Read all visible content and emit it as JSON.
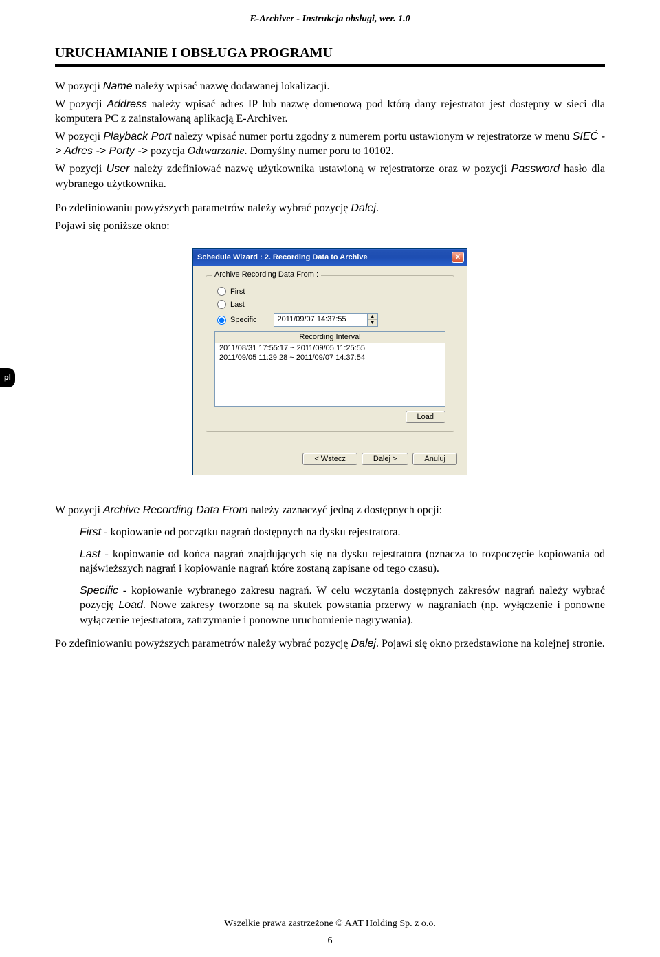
{
  "doc": {
    "header": "E-Archiver - Instrukcja obsługi, wer. 1.0",
    "section_title": "URUCHAMIANIE I OBSŁUGA PROGRAMU",
    "lang_tab": "pl",
    "footer": "Wszelkie prawa zastrzeżone © AAT Holding Sp. z o.o.",
    "page_number": "6"
  },
  "para": {
    "p1a": "W pozycji ",
    "p1_name": "Name",
    "p1b": " należy wpisać nazwę dodawanej lokalizacji.",
    "p2a": "W pozycji ",
    "p2_addr": "Address",
    "p2b": " należy wpisać adres IP lub nazwę domenową pod którą dany rejestrator jest dostępny w sieci dla komputera PC z zainstalowaną aplikacją E-Archiver.",
    "p3a": "W pozycji ",
    "p3_pb": "Playback Port",
    "p3b": " należy wpisać numer portu zgodny z numerem portu ustawionym w rejestratorze w menu ",
    "p3_menu": "SIEĆ -> Adres -> Porty ->",
    "p3c": " pozycja ",
    "p3_odt": "Odtwarzanie",
    "p3d": ". Domyślny numer poru to 10102.",
    "p4a": "W pozycji ",
    "p4_user": "User",
    "p4b": " należy zdefiniować nazwę użytkownika ustawioną w rejestratorze oraz w pozycji ",
    "p4_pw": "Password",
    "p4c": " hasło dla wybranego użytkownika.",
    "p5a": "Po zdefiniowaniu powyższych parametrów należy wybrać pozycję ",
    "p5_dalej": "Dalej",
    "p5b": ".",
    "p6": "Pojawi się poniższe okno:"
  },
  "dialog": {
    "title": "Schedule Wizard : 2. Recording Data to Archive",
    "group_label": "Archive Recording Data From :",
    "opt_first": "First",
    "opt_last": "Last",
    "opt_specific": "Specific",
    "specific_value": "2011/09/07 14:37:55",
    "interval_header": "Recording Interval",
    "intervals": [
      "2011/08/31 17:55:17 ~ 2011/09/05 11:25:55",
      "2011/09/05 11:29:28 ~ 2011/09/07 14:37:54"
    ],
    "load": "Load",
    "back": "< Wstecz",
    "next": "Dalej >",
    "cancel": "Anuluj",
    "close": "X"
  },
  "lower": {
    "intro_a": "W pozycji ",
    "intro_field": "Archive Recording Data From",
    "intro_b": " należy zaznaczyć jedną z dostępnych opcji:",
    "first_label": "First",
    "first_text": " - kopiowanie od początku nagrań dostępnych na dysku rejestratora.",
    "last_label": "Last",
    "last_text": " - kopiowanie od końca nagrań znajdujących się na dysku rejestratora (oznacza to rozpoczęcie kopiowania od najświeższych nagrań i kopiowanie nagrań które zostaną zapisane od tego czasu).",
    "spec_label": "Specific",
    "spec_text_a": " - kopiowanie wybranego zakresu nagrań. W celu wczytania dostępnych zakresów nagrań należy wybrać pozycję ",
    "spec_load": "Load",
    "spec_text_b": ". Nowe zakresy tworzone są na skutek powstania przerwy w nagraniach (np. wyłączenie i ponowne wyłączenie rejestratora, zatrzymanie i ponowne uruchomienie nagrywania).",
    "outro_a": "Po zdefiniowaniu powyższych parametrów należy wybrać pozycję ",
    "outro_dalej": "Dalej",
    "outro_b": ". Pojawi się okno przedstawione na kolejnej stronie."
  }
}
